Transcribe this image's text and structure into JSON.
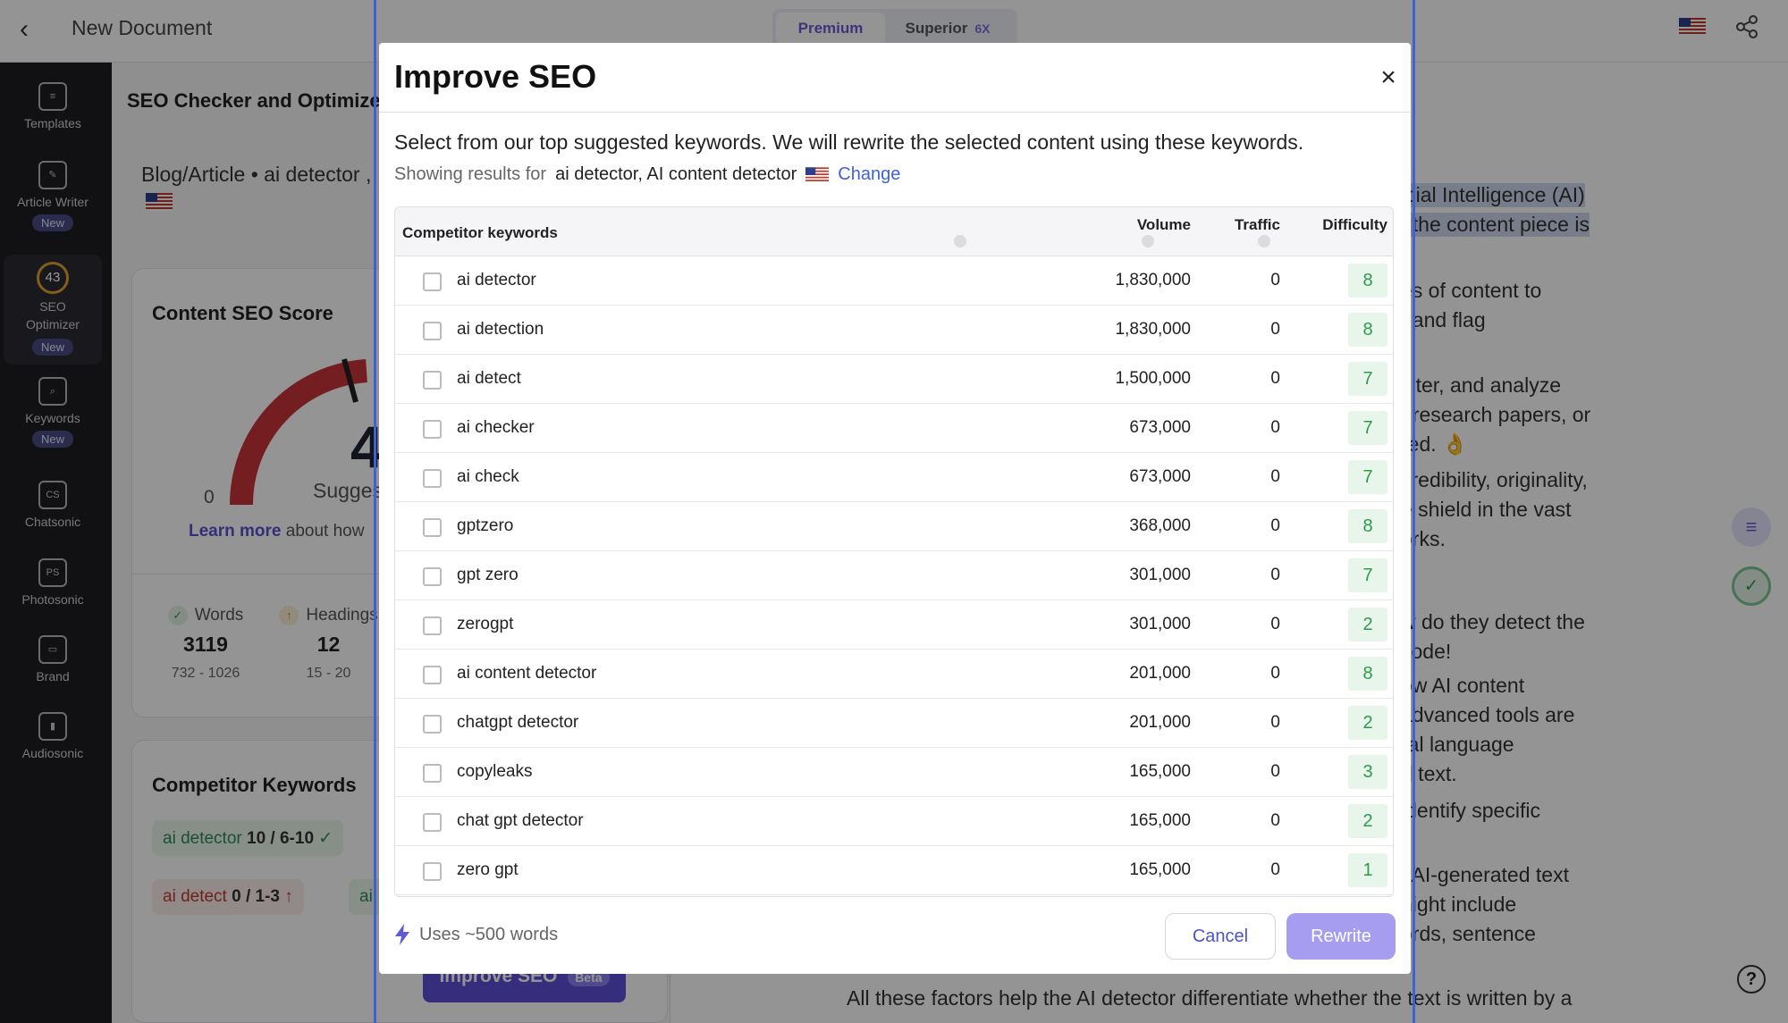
{
  "topbar": {
    "title": "New Document",
    "plans": [
      {
        "label": "Premium"
      },
      {
        "label": "Superior",
        "multiplier": "6X"
      }
    ]
  },
  "rail": {
    "items": [
      {
        "label": "Templates",
        "icon": "templates-icon"
      },
      {
        "label": "Article Writer",
        "badge": "New",
        "icon": "article-writer-icon"
      },
      {
        "label": "SEO Optimizer",
        "badge": "New",
        "score": "43"
      },
      {
        "label": "Keywords",
        "badge": "New",
        "icon": "keywords-icon"
      },
      {
        "label": "Chatsonic",
        "icon_text": "CS"
      },
      {
        "label": "Photosonic",
        "icon_text": "PS"
      },
      {
        "label": "Brand",
        "icon": "brand-icon"
      },
      {
        "label": "Audiosonic",
        "icon": "audiosonic-icon"
      }
    ]
  },
  "panel": {
    "title": "SEO Checker and Optimize",
    "subtitle": "Blog/Article • ai detector ,",
    "score_title": "Content SEO Score",
    "gauge_min": "0",
    "score_partial": "4",
    "suggest_partial": "Sugges",
    "learn_more": "Learn more",
    "learn_rest": "about how",
    "stats": [
      {
        "label": "Words",
        "value": "3119",
        "range": "732 - 1026",
        "status": "ok"
      },
      {
        "label": "Headings",
        "value": "12",
        "range": "15 - 20",
        "status": "up"
      }
    ],
    "competitor_title": "Competitor Keywords",
    "chips": [
      {
        "kw": "ai detector",
        "count": "10 / 6-10",
        "type": "green"
      },
      {
        "kw": "ai detect",
        "count": "0 / 1-3",
        "type": "red"
      },
      {
        "kw": "ai",
        "count": "",
        "type": "green"
      }
    ],
    "improve_button": "Improve SEO",
    "improve_badge": "Beta"
  },
  "doc": {
    "lines": [
      "icial Intelligence (AI)",
      "f the content piece is",
      "es of content to",
      ", and flag",
      "filter, and analyze",
      ", research papers, or",
      "red. 👌",
      "credibility, originality,",
      "e shield in the vast",
      "orks.",
      "w do they detect the",
      "code!",
      "ow AI content",
      "advanced tools are",
      "ral language",
      "d text.",
      "identify specific",
      "t AI-generated text",
      "night include",
      "ords, sentence",
      "All these factors help the AI detector differentiate whether the text is written by a"
    ]
  },
  "modal": {
    "title": "Improve SEO",
    "intro": "Select from our top suggested keywords. We will rewrite the selected content using these keywords.",
    "showing_label": "Showing results for",
    "showing_terms": "ai detector, AI content detector",
    "change_label": "Change",
    "columns": {
      "keyword": "Competitor keywords",
      "volume": "Volume",
      "traffic": "Traffic",
      "difficulty": "Difficulty"
    },
    "rows": [
      {
        "keyword": "ai detector",
        "volume": "1,830,000",
        "traffic": "0",
        "difficulty": "8"
      },
      {
        "keyword": "ai detection",
        "volume": "1,830,000",
        "traffic": "0",
        "difficulty": "8"
      },
      {
        "keyword": "ai detect",
        "volume": "1,500,000",
        "traffic": "0",
        "difficulty": "7"
      },
      {
        "keyword": "ai checker",
        "volume": "673,000",
        "traffic": "0",
        "difficulty": "7"
      },
      {
        "keyword": "ai check",
        "volume": "673,000",
        "traffic": "0",
        "difficulty": "7"
      },
      {
        "keyword": "gptzero",
        "volume": "368,000",
        "traffic": "0",
        "difficulty": "8"
      },
      {
        "keyword": "gpt zero",
        "volume": "301,000",
        "traffic": "0",
        "difficulty": "7"
      },
      {
        "keyword": "zerogpt",
        "volume": "301,000",
        "traffic": "0",
        "difficulty": "2"
      },
      {
        "keyword": "ai content detector",
        "volume": "201,000",
        "traffic": "0",
        "difficulty": "8"
      },
      {
        "keyword": "chatgpt detector",
        "volume": "201,000",
        "traffic": "0",
        "difficulty": "2"
      },
      {
        "keyword": "copyleaks",
        "volume": "165,000",
        "traffic": "0",
        "difficulty": "3"
      },
      {
        "keyword": "chat gpt detector",
        "volume": "165,000",
        "traffic": "0",
        "difficulty": "2"
      },
      {
        "keyword": "zero gpt",
        "volume": "165,000",
        "traffic": "0",
        "difficulty": "1"
      }
    ],
    "usage_note": "Uses ~500 words",
    "cancel_label": "Cancel",
    "rewrite_label": "Rewrite"
  }
}
